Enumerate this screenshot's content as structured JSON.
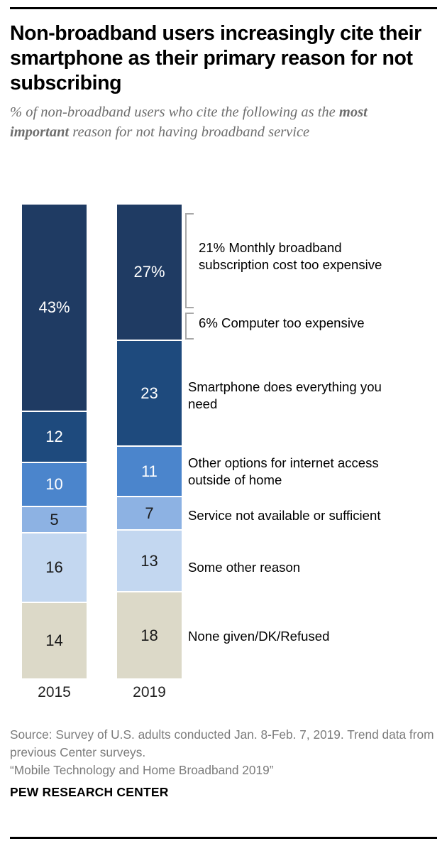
{
  "header": {
    "title": "Non-broadband users increasingly cite their smartphone as their primary reason for not subscribing",
    "subtitle_part1": "% of non-broadband users who cite the following as the ",
    "subtitle_emphasis": "most important",
    "subtitle_part2": " reason for not having broadband service"
  },
  "chart_data": {
    "type": "bar",
    "subtype": "stacked-column",
    "title": "Non-broadband users increasingly cite their smartphone as their primary reason for not subscribing",
    "subtitle": "% of non-broadband users who cite the following as the most important reason for not having broadband service",
    "xlabel": "",
    "ylabel": "%",
    "ylim": [
      0,
      100
    ],
    "grid": false,
    "legend_position": "right-annotations",
    "categories": [
      "2015",
      "2019"
    ],
    "series": [
      {
        "name": "Cost (monthly subscription and/or computer too expensive)",
        "color": "#1F3B63",
        "values": [
          43,
          27
        ]
      },
      {
        "name": "Smartphone does everything you need",
        "color": "#1E4A7D",
        "values": [
          12,
          23
        ]
      },
      {
        "name": "Other options for internet access outside of home",
        "color": "#4B85CC",
        "values": [
          10,
          11
        ]
      },
      {
        "name": "Service not available or sufficient",
        "color": "#8DB2E3",
        "values": [
          5,
          7
        ]
      },
      {
        "name": "Some other reason",
        "color": "#C3D7F0",
        "values": [
          16,
          13
        ]
      },
      {
        "name": "None given/DK/Refused",
        "color": "#DCD9C8",
        "values": [
          14,
          18
        ]
      }
    ],
    "value_labels": {
      "2015": [
        "43%",
        "12",
        "10",
        "5",
        "16",
        "14"
      ],
      "2019": [
        "27%",
        "23",
        "11",
        "7",
        "13",
        "18"
      ]
    },
    "annotations": [
      {
        "id": "cost-subscription",
        "text": "21% Monthly broadband subscription cost too expensive",
        "value": 21
      },
      {
        "id": "cost-computer",
        "text": "6% Computer too expensive",
        "value": 6
      },
      {
        "id": "smartphone",
        "text": "Smartphone does everything you need",
        "value": 23
      },
      {
        "id": "other-options",
        "text": "Other options for internet access outside of home",
        "value": 11
      },
      {
        "id": "service",
        "text": "Service not available or sufficient",
        "value": 7
      },
      {
        "id": "other-reason",
        "text": "Some other reason",
        "value": 13
      },
      {
        "id": "none-given",
        "text": "None given/DK/Refused",
        "value": 18
      }
    ]
  },
  "bars": {
    "y2015": {
      "year": "2015",
      "segments": [
        {
          "label": "43%",
          "color": "#1F3B63",
          "text": "light"
        },
        {
          "label": "12",
          "color": "#1E4A7D",
          "text": "light"
        },
        {
          "label": "10",
          "color": "#4B85CC",
          "text": "light"
        },
        {
          "label": "5",
          "color": "#8DB2E3",
          "text": "dark"
        },
        {
          "label": "16",
          "color": "#C3D7F0",
          "text": "dark"
        },
        {
          "label": "14",
          "color": "#DCD9C8",
          "text": "dark"
        }
      ]
    },
    "y2019": {
      "year": "2019",
      "segments": [
        {
          "label": "27%",
          "color": "#1F3B63",
          "text": "light"
        },
        {
          "label": "23",
          "color": "#1E4A7D",
          "text": "light"
        },
        {
          "label": "11",
          "color": "#4B85CC",
          "text": "light"
        },
        {
          "label": "7",
          "color": "#8DB2E3",
          "text": "dark"
        },
        {
          "label": "13",
          "color": "#C3D7F0",
          "text": "dark"
        },
        {
          "label": "18",
          "color": "#DCD9C8",
          "text": "dark"
        }
      ]
    }
  },
  "annotations": {
    "cost_subscription": "21% Monthly broadband subscription cost too expensive",
    "cost_computer": "6% Computer too expensive",
    "smartphone": "Smartphone does everything you need",
    "other_options": "Other options for internet access outside of home",
    "service": "Service not available or sufficient",
    "other_reason": "Some other reason",
    "none_given": "None given/DK/Refused"
  },
  "footer": {
    "source_line1": "Source: Survey of U.S. adults conducted Jan. 8-Feb. 7, 2019. Trend data from previous Center surveys.",
    "source_line2": "“Mobile Technology and Home Broadband 2019”",
    "brand": "PEW RESEARCH CENTER"
  },
  "colors": {
    "navy": "#1F3B63",
    "navy_mid": "#1E4A7D",
    "blue": "#4B85CC",
    "blue_light": "#8DB2E3",
    "blue_pale": "#C3D7F0",
    "beige": "#DCD9C8",
    "bracket": "#a8a8a8",
    "subtitle_gray": "#6e6e6e",
    "source_gray": "#7b7b7b"
  }
}
